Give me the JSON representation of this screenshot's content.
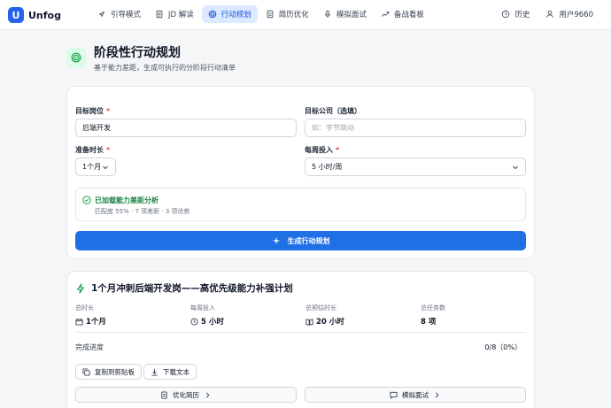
{
  "brand": {
    "logo_letter": "U",
    "name": "Unfog",
    "color": "#2563eb"
  },
  "nav": {
    "items": [
      {
        "label": "引导模式",
        "icon": "compass-icon"
      },
      {
        "label": "JD 解读",
        "icon": "document-icon"
      },
      {
        "label": "行动规划",
        "icon": "target-icon",
        "active": true
      },
      {
        "label": "简历优化",
        "icon": "file-edit-icon"
      },
      {
        "label": "模拟面试",
        "icon": "microphone-icon"
      },
      {
        "label": "备战看板",
        "icon": "trend-icon"
      }
    ],
    "history": "历史",
    "user": "用户9660"
  },
  "page": {
    "title": "阶段性行动规划",
    "subtitle": "基于能力差距，生成可执行的分阶段行动清单"
  },
  "form": {
    "target_role_label": "目标岗位",
    "target_role_value": "后端开发",
    "target_company_label": "目标公司（选填）",
    "target_company_placeholder": "如：字节跳动",
    "duration_label": "准备时长",
    "duration_value": "1个月",
    "weekly_label": "每周投入",
    "weekly_value": "5 小时/周",
    "required_mark": "*",
    "analysis_title": "已加载能力差距分析",
    "analysis_sub": "匹配度 55% · 7 项差距 · 3 项优势",
    "generate_label": "生成行动规划"
  },
  "plan": {
    "title": "1个月冲刺后端开发岗——高优先级能力补强计划",
    "stats": [
      {
        "label": "总时长",
        "value": "1个月",
        "icon": "calendar-icon"
      },
      {
        "label": "每周投入",
        "value": "5 小时",
        "icon": "clock-icon"
      },
      {
        "label": "总预估时长",
        "value": "20 小时",
        "icon": "book-icon"
      },
      {
        "label": "总任务数",
        "value": "8 项",
        "icon": ""
      }
    ],
    "progress_label": "完成进度",
    "progress_value": "0/8（0%）",
    "progress_fraction": 0,
    "copy_label": "复制到剪贴板",
    "download_label": "下载文本",
    "resume_label": "优化简历",
    "interview_label": "模拟面试"
  },
  "colors": {
    "accent": "#1f6fe5",
    "success": "#15803d",
    "required": "#ef4444"
  }
}
